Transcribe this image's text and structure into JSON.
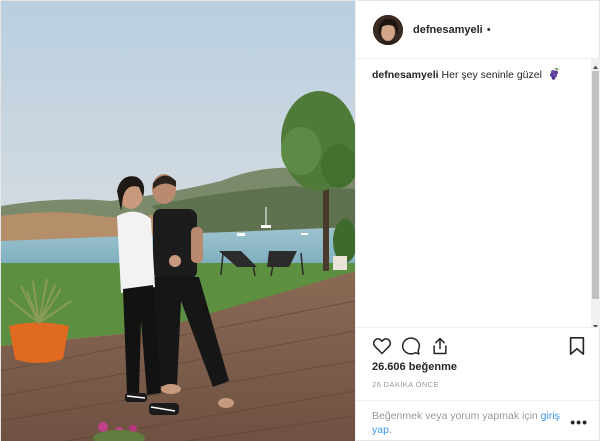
{
  "post": {
    "username": "defnesamyeli",
    "header_separator": "•",
    "caption_username": "defnesamyeli",
    "caption_text": "Her şey seninle güzel",
    "caption_emoji": "grapes-emoji",
    "likes": "26.606 beğenme",
    "timestamp": "26 DAKİKA ÖNCE"
  },
  "login_prompt": {
    "text": "Beğenmek veya yorum yapmak için",
    "link": "giriş yap",
    "link_color": "#3897f0"
  },
  "more_options": "•••",
  "icons": [
    "heart-icon",
    "comment-icon",
    "share-icon",
    "bookmark-icon",
    "grapes-emoji"
  ],
  "colors": {
    "text": "#262626",
    "muted": "#999999",
    "link": "#3897f0",
    "border": "#efefef"
  }
}
